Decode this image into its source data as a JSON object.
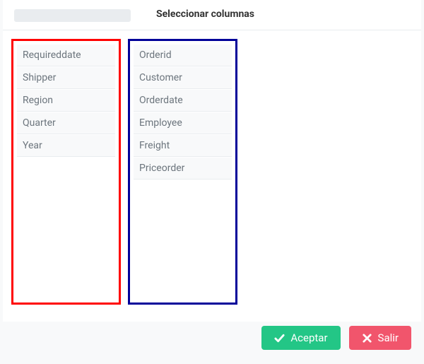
{
  "tabs": {
    "select_columns": "Seleccionar columnas"
  },
  "columns": {
    "left": [
      "Requireddate",
      "Shipper",
      "Region",
      "Quarter",
      "Year"
    ],
    "right": [
      "Orderid",
      "Customer",
      "Orderdate",
      "Employee",
      "Freight",
      "Priceorder"
    ]
  },
  "buttons": {
    "accept": "Aceptar",
    "exit": "Salir"
  },
  "colors": {
    "left_border": "#ff0000",
    "right_border": "#000099",
    "accept_bg": "#23c686",
    "exit_bg": "#f1556c"
  }
}
